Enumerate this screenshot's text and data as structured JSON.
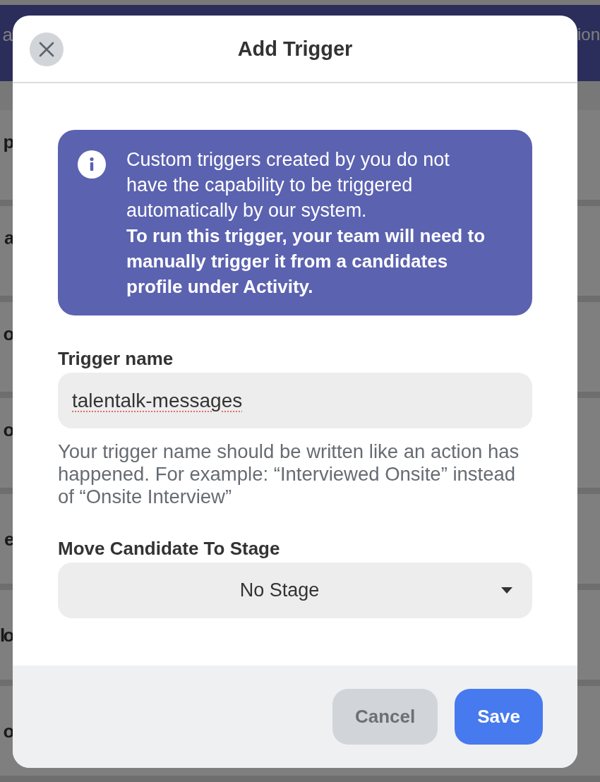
{
  "background_page": {
    "header": {
      "left_text": "a",
      "right_text": "ion"
    },
    "rows": [
      {
        "kind": "two_line",
        "title": "p"
      },
      {
        "kind": "two_line",
        "title": "a"
      },
      {
        "kind": "two_line",
        "title": "o"
      },
      {
        "kind": "two_line",
        "title": "o"
      },
      {
        "kind": "one_line",
        "title": "e"
      },
      {
        "kind": "one_line",
        "title": "lo"
      },
      {
        "kind": "one_line",
        "title": "o"
      }
    ]
  },
  "dialog": {
    "title": "Add Trigger",
    "info": {
      "message": "Custom triggers created by you do not have the capability to be triggered automatically by our system.",
      "instruction": "To run this trigger, your team will need to manually trigger it from a candidates profile under Activity."
    },
    "fields": [
      {
        "kind": "text",
        "label": "Trigger name",
        "value": "talentalk-messages",
        "misspelled": true,
        "help_text": "Your trigger name should be written like an action has happened. For example: “Interviewed Onsite” instead of “Onsite Interview”"
      },
      {
        "kind": "select",
        "label": "Move Candidate To Stage",
        "value": "No Stage"
      }
    ],
    "buttons": [
      {
        "kind": "secondary",
        "label": "Cancel"
      },
      {
        "kind": "primary",
        "label": "Save"
      }
    ]
  }
}
